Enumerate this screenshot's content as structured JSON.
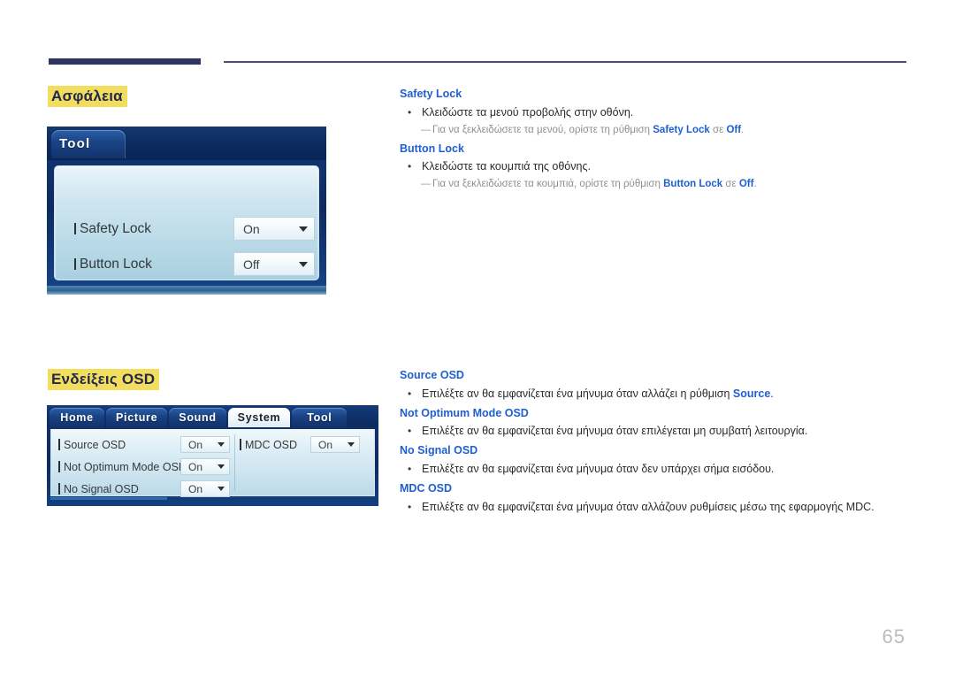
{
  "page": {
    "number": "65"
  },
  "sections": [
    {
      "id": "safety",
      "heading": "Ασφάλεια",
      "panel": {
        "type": "osd-single-tab",
        "tab_label": "Tool",
        "rows": [
          {
            "label": "Safety Lock",
            "value": "On"
          },
          {
            "label": "Button Lock",
            "value": "Off"
          }
        ]
      },
      "blocks": [
        {
          "title": "Safety Lock",
          "bullet": "Κλειδώστε τα μενού προβολής στην οθόνη.",
          "note_prefix": "Για να ξεκλειδώσετε τα μενού, ορίστε τη ρύθμιση ",
          "note_bold_1": "Safety Lock",
          "note_middle": " σε ",
          "note_bold_2": "Off",
          "note_suffix": "."
        },
        {
          "title": "Button Lock",
          "bullet": "Κλειδώστε τα κουμπιά της οθόνης.",
          "note_prefix": "Για να ξεκλειδώσετε τα κουμπιά, ορίστε τη ρύθμιση ",
          "note_bold_1": "Button Lock",
          "note_middle": " σε ",
          "note_bold_2": "Off",
          "note_suffix": "."
        }
      ]
    },
    {
      "id": "osd",
      "heading": "Ενδείξεις OSD",
      "panel": {
        "type": "osd-tabbed",
        "tabs": [
          {
            "label": "Home",
            "active": false
          },
          {
            "label": "Picture",
            "active": false
          },
          {
            "label": "Sound",
            "active": false
          },
          {
            "label": "System",
            "active": true
          },
          {
            "label": "Tool",
            "active": false
          }
        ],
        "column_a": [
          {
            "label": "Source OSD",
            "value": "On"
          },
          {
            "label": "Not Optimum Mode OSD",
            "value": "On"
          },
          {
            "label": "No Signal OSD",
            "value": "On"
          }
        ],
        "column_b": [
          {
            "label": "MDC OSD",
            "value": "On"
          }
        ]
      },
      "blocks": [
        {
          "title": "Source OSD",
          "bullet_prefix": "Επιλέξτε αν θα εμφανίζεται ένα μήνυμα όταν αλλάζει η ρύθμιση ",
          "bullet_bold": "Source",
          "bullet_suffix": "."
        },
        {
          "title": "Not Optimum Mode OSD",
          "bullet": "Επιλέξτε αν θα εμφανίζεται ένα μήνυμα όταν επιλέγεται μη συμβατή λειτουργία."
        },
        {
          "title": "No Signal OSD",
          "bullet": "Επιλέξτε αν θα εμφανίζεται ένα μήνυμα όταν δεν υπάρχει σήμα εισόδου."
        },
        {
          "title": "MDC OSD",
          "bullet": "Επιλέξτε αν θα εμφανίζεται ένα μήνυμα όταν αλλάζουν ρυθμίσεις μέσω της εφαρμογής MDC."
        }
      ]
    }
  ],
  "glyphs": {
    "bullet": "•",
    "note_dash": "―"
  },
  "colors": {
    "heading_highlight": "#F2DE5E",
    "heading_text": "#22284D",
    "link_blue": "#1F5FD0",
    "rule_navy": "#2E3561",
    "note_gray": "#8F8F8F"
  }
}
